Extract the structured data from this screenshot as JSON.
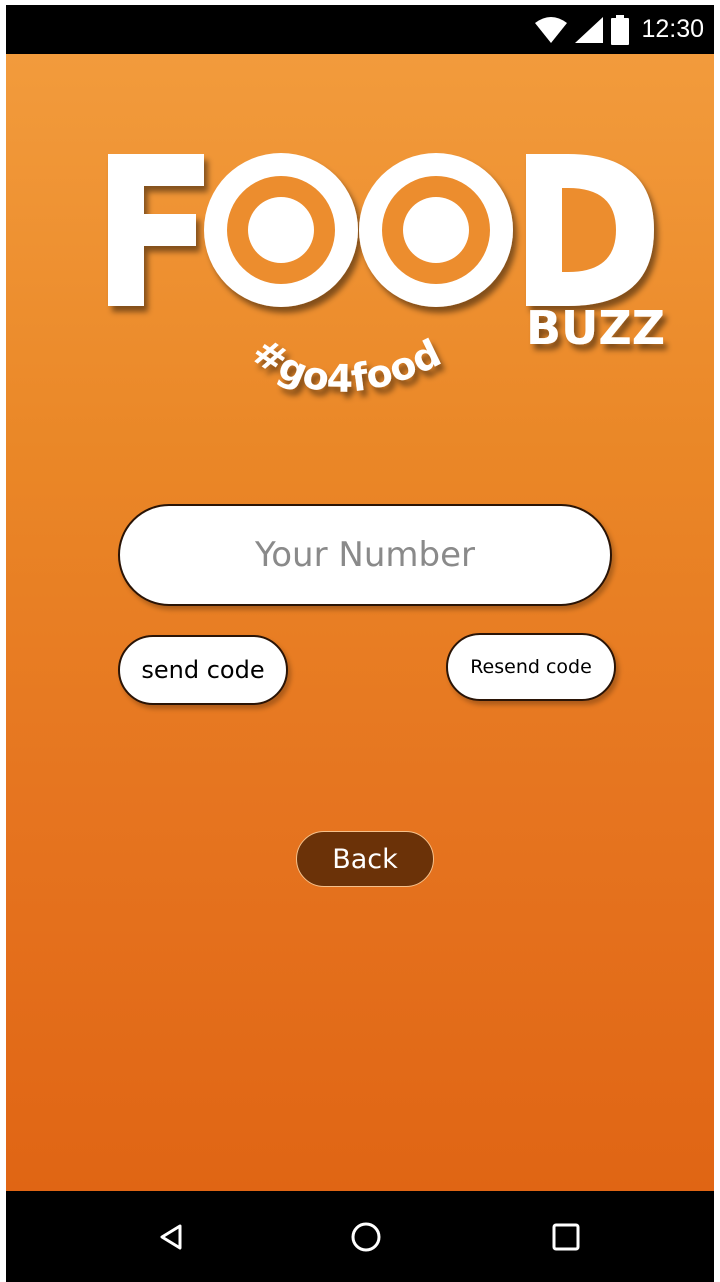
{
  "status_bar": {
    "time": "12:30",
    "icons": [
      "wifi-icon",
      "signal-icon",
      "battery-icon"
    ]
  },
  "logo": {
    "brand": "FOOD",
    "sub": "BUZZ",
    "tagline": "#go4food"
  },
  "form": {
    "number_placeholder": "Your Number",
    "number_value": ""
  },
  "buttons": {
    "send_code": "send code",
    "resend_code": "Resend code",
    "back": "Back"
  },
  "nav_bar": {
    "icons": [
      "back-triangle-icon",
      "home-circle-icon",
      "recents-square-icon"
    ]
  },
  "colors": {
    "gradient_top": "#f29b3c",
    "gradient_bottom": "#e06514",
    "back_button": "#6b3208",
    "logo_text": "#ffffff"
  }
}
